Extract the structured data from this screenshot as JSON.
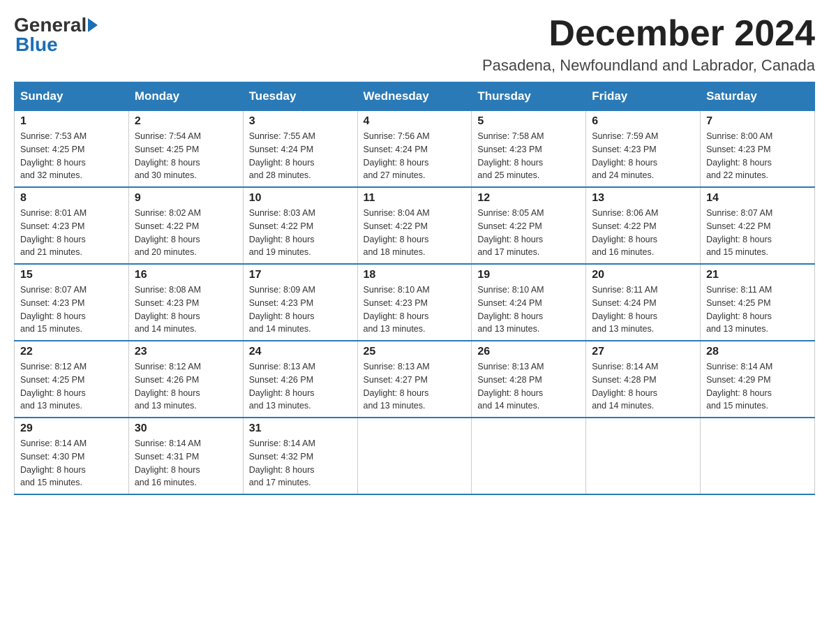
{
  "logo": {
    "general": "General",
    "blue": "Blue"
  },
  "title": "December 2024",
  "location": "Pasadena, Newfoundland and Labrador, Canada",
  "weekdays": [
    "Sunday",
    "Monday",
    "Tuesday",
    "Wednesday",
    "Thursday",
    "Friday",
    "Saturday"
  ],
  "weeks": [
    [
      {
        "day": "1",
        "sunrise": "7:53 AM",
        "sunset": "4:25 PM",
        "daylight": "8 hours and 32 minutes."
      },
      {
        "day": "2",
        "sunrise": "7:54 AM",
        "sunset": "4:25 PM",
        "daylight": "8 hours and 30 minutes."
      },
      {
        "day": "3",
        "sunrise": "7:55 AM",
        "sunset": "4:24 PM",
        "daylight": "8 hours and 28 minutes."
      },
      {
        "day": "4",
        "sunrise": "7:56 AM",
        "sunset": "4:24 PM",
        "daylight": "8 hours and 27 minutes."
      },
      {
        "day": "5",
        "sunrise": "7:58 AM",
        "sunset": "4:23 PM",
        "daylight": "8 hours and 25 minutes."
      },
      {
        "day": "6",
        "sunrise": "7:59 AM",
        "sunset": "4:23 PM",
        "daylight": "8 hours and 24 minutes."
      },
      {
        "day": "7",
        "sunrise": "8:00 AM",
        "sunset": "4:23 PM",
        "daylight": "8 hours and 22 minutes."
      }
    ],
    [
      {
        "day": "8",
        "sunrise": "8:01 AM",
        "sunset": "4:23 PM",
        "daylight": "8 hours and 21 minutes."
      },
      {
        "day": "9",
        "sunrise": "8:02 AM",
        "sunset": "4:22 PM",
        "daylight": "8 hours and 20 minutes."
      },
      {
        "day": "10",
        "sunrise": "8:03 AM",
        "sunset": "4:22 PM",
        "daylight": "8 hours and 19 minutes."
      },
      {
        "day": "11",
        "sunrise": "8:04 AM",
        "sunset": "4:22 PM",
        "daylight": "8 hours and 18 minutes."
      },
      {
        "day": "12",
        "sunrise": "8:05 AM",
        "sunset": "4:22 PM",
        "daylight": "8 hours and 17 minutes."
      },
      {
        "day": "13",
        "sunrise": "8:06 AM",
        "sunset": "4:22 PM",
        "daylight": "8 hours and 16 minutes."
      },
      {
        "day": "14",
        "sunrise": "8:07 AM",
        "sunset": "4:22 PM",
        "daylight": "8 hours and 15 minutes."
      }
    ],
    [
      {
        "day": "15",
        "sunrise": "8:07 AM",
        "sunset": "4:23 PM",
        "daylight": "8 hours and 15 minutes."
      },
      {
        "day": "16",
        "sunrise": "8:08 AM",
        "sunset": "4:23 PM",
        "daylight": "8 hours and 14 minutes."
      },
      {
        "day": "17",
        "sunrise": "8:09 AM",
        "sunset": "4:23 PM",
        "daylight": "8 hours and 14 minutes."
      },
      {
        "day": "18",
        "sunrise": "8:10 AM",
        "sunset": "4:23 PM",
        "daylight": "8 hours and 13 minutes."
      },
      {
        "day": "19",
        "sunrise": "8:10 AM",
        "sunset": "4:24 PM",
        "daylight": "8 hours and 13 minutes."
      },
      {
        "day": "20",
        "sunrise": "8:11 AM",
        "sunset": "4:24 PM",
        "daylight": "8 hours and 13 minutes."
      },
      {
        "day": "21",
        "sunrise": "8:11 AM",
        "sunset": "4:25 PM",
        "daylight": "8 hours and 13 minutes."
      }
    ],
    [
      {
        "day": "22",
        "sunrise": "8:12 AM",
        "sunset": "4:25 PM",
        "daylight": "8 hours and 13 minutes."
      },
      {
        "day": "23",
        "sunrise": "8:12 AM",
        "sunset": "4:26 PM",
        "daylight": "8 hours and 13 minutes."
      },
      {
        "day": "24",
        "sunrise": "8:13 AM",
        "sunset": "4:26 PM",
        "daylight": "8 hours and 13 minutes."
      },
      {
        "day": "25",
        "sunrise": "8:13 AM",
        "sunset": "4:27 PM",
        "daylight": "8 hours and 13 minutes."
      },
      {
        "day": "26",
        "sunrise": "8:13 AM",
        "sunset": "4:28 PM",
        "daylight": "8 hours and 14 minutes."
      },
      {
        "day": "27",
        "sunrise": "8:14 AM",
        "sunset": "4:28 PM",
        "daylight": "8 hours and 14 minutes."
      },
      {
        "day": "28",
        "sunrise": "8:14 AM",
        "sunset": "4:29 PM",
        "daylight": "8 hours and 15 minutes."
      }
    ],
    [
      {
        "day": "29",
        "sunrise": "8:14 AM",
        "sunset": "4:30 PM",
        "daylight": "8 hours and 15 minutes."
      },
      {
        "day": "30",
        "sunrise": "8:14 AM",
        "sunset": "4:31 PM",
        "daylight": "8 hours and 16 minutes."
      },
      {
        "day": "31",
        "sunrise": "8:14 AM",
        "sunset": "4:32 PM",
        "daylight": "8 hours and 17 minutes."
      },
      null,
      null,
      null,
      null
    ]
  ],
  "labels": {
    "sunrise": "Sunrise:",
    "sunset": "Sunset:",
    "daylight": "Daylight:"
  }
}
